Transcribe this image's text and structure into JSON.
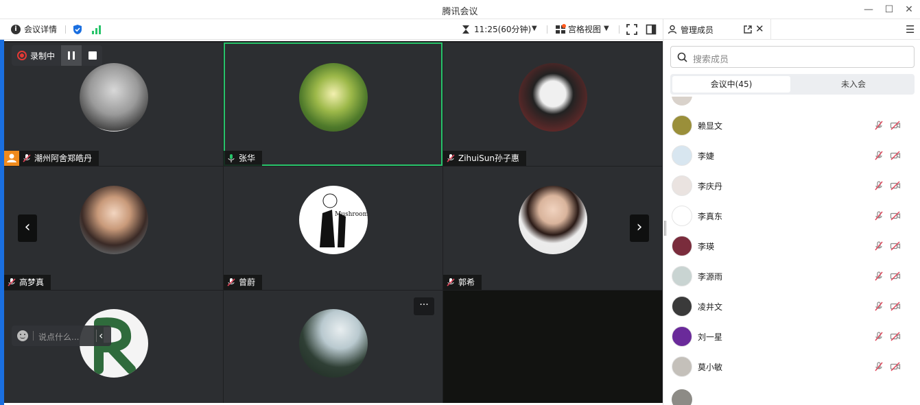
{
  "app": {
    "title": "腾讯会议"
  },
  "toolbar": {
    "meeting_details": "会议详情",
    "timer": "11:25(60分钟)",
    "grid_view": "宫格视图"
  },
  "recording": {
    "label": "录制中"
  },
  "chat": {
    "placeholder": "说点什么..."
  },
  "grid": {
    "tiles": [
      {
        "name": "潮州阿舍郑皓丹"
      },
      {
        "name": "张华"
      },
      {
        "name": "ZihuiSun孙子惠"
      },
      {
        "name": "高梦真"
      },
      {
        "name": "曾蔚"
      },
      {
        "name": "郭希"
      }
    ]
  },
  "sidebar": {
    "title": "管理成员",
    "search_placeholder": "搜索成员",
    "tab_in_meeting": "会议中(45)",
    "tab_not_joined": "未入会",
    "members": [
      {
        "name": "赖显文"
      },
      {
        "name": "李婕"
      },
      {
        "name": "李庆丹"
      },
      {
        "name": "李真东"
      },
      {
        "name": "李瑛"
      },
      {
        "name": "李源雨"
      },
      {
        "name": "凌井文"
      },
      {
        "name": "刘一星"
      },
      {
        "name": "莫小敏"
      }
    ]
  },
  "colors": {
    "accent": "#1a6fe0",
    "active_speaker": "#27c46a",
    "muted": "#e0455a",
    "record": "#e53935"
  }
}
